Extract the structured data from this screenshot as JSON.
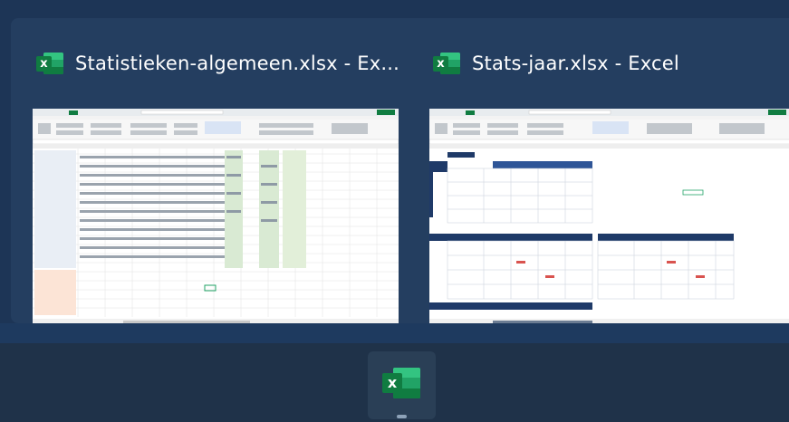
{
  "taskbar_preview": {
    "windows": [
      {
        "title": "Statistieken-algemeen.xlsx - Ex...",
        "app_icon": "excel-icon",
        "icon_letter": "x"
      },
      {
        "title": "Stats-jaar.xlsx - Excel",
        "app_icon": "excel-icon",
        "icon_letter": "x"
      }
    ]
  },
  "taskbar": {
    "app_icon": "excel-icon",
    "icon_letter": "x",
    "running": true
  },
  "colors": {
    "panel": "#243e60",
    "taskbar": "#1f3249",
    "excel_green": "#107c41",
    "header_blue": "#1f3a68"
  }
}
